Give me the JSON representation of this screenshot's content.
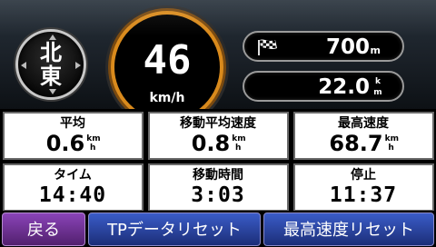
{
  "compass": {
    "line1": "北",
    "line2": "東"
  },
  "speed": {
    "value": "46",
    "unit": "km/h"
  },
  "distance": {
    "icon": "checkered-flag-icon",
    "value": "700",
    "unit": "m"
  },
  "odometer": {
    "value": "22.0",
    "unit_top": "k",
    "unit_bottom": "m"
  },
  "stats": {
    "average": {
      "label": "平均",
      "value": "0.6",
      "unit_top": "km",
      "unit_bottom": "h"
    },
    "moving_average": {
      "label": "移動平均速度",
      "value": "0.8",
      "unit_top": "km",
      "unit_bottom": "h"
    },
    "max_speed": {
      "label": "最高速度",
      "value": "68.7",
      "unit_top": "km",
      "unit_bottom": "h"
    },
    "time": {
      "label": "タイム",
      "value": "14:40"
    },
    "moving_time": {
      "label": "移動時間",
      "value": "3:03"
    },
    "stopped": {
      "label": "停止",
      "value": "11:37"
    }
  },
  "buttons": {
    "back": "戻る",
    "tp_reset": "TPデータリセット",
    "max_speed_reset": "最高速度リセット"
  },
  "colors": {
    "speedo_ring": "#d98a1c",
    "back_button": "#8a44b8",
    "reset_buttons": "#3a5cc8",
    "cell_background": "#ffffff"
  }
}
